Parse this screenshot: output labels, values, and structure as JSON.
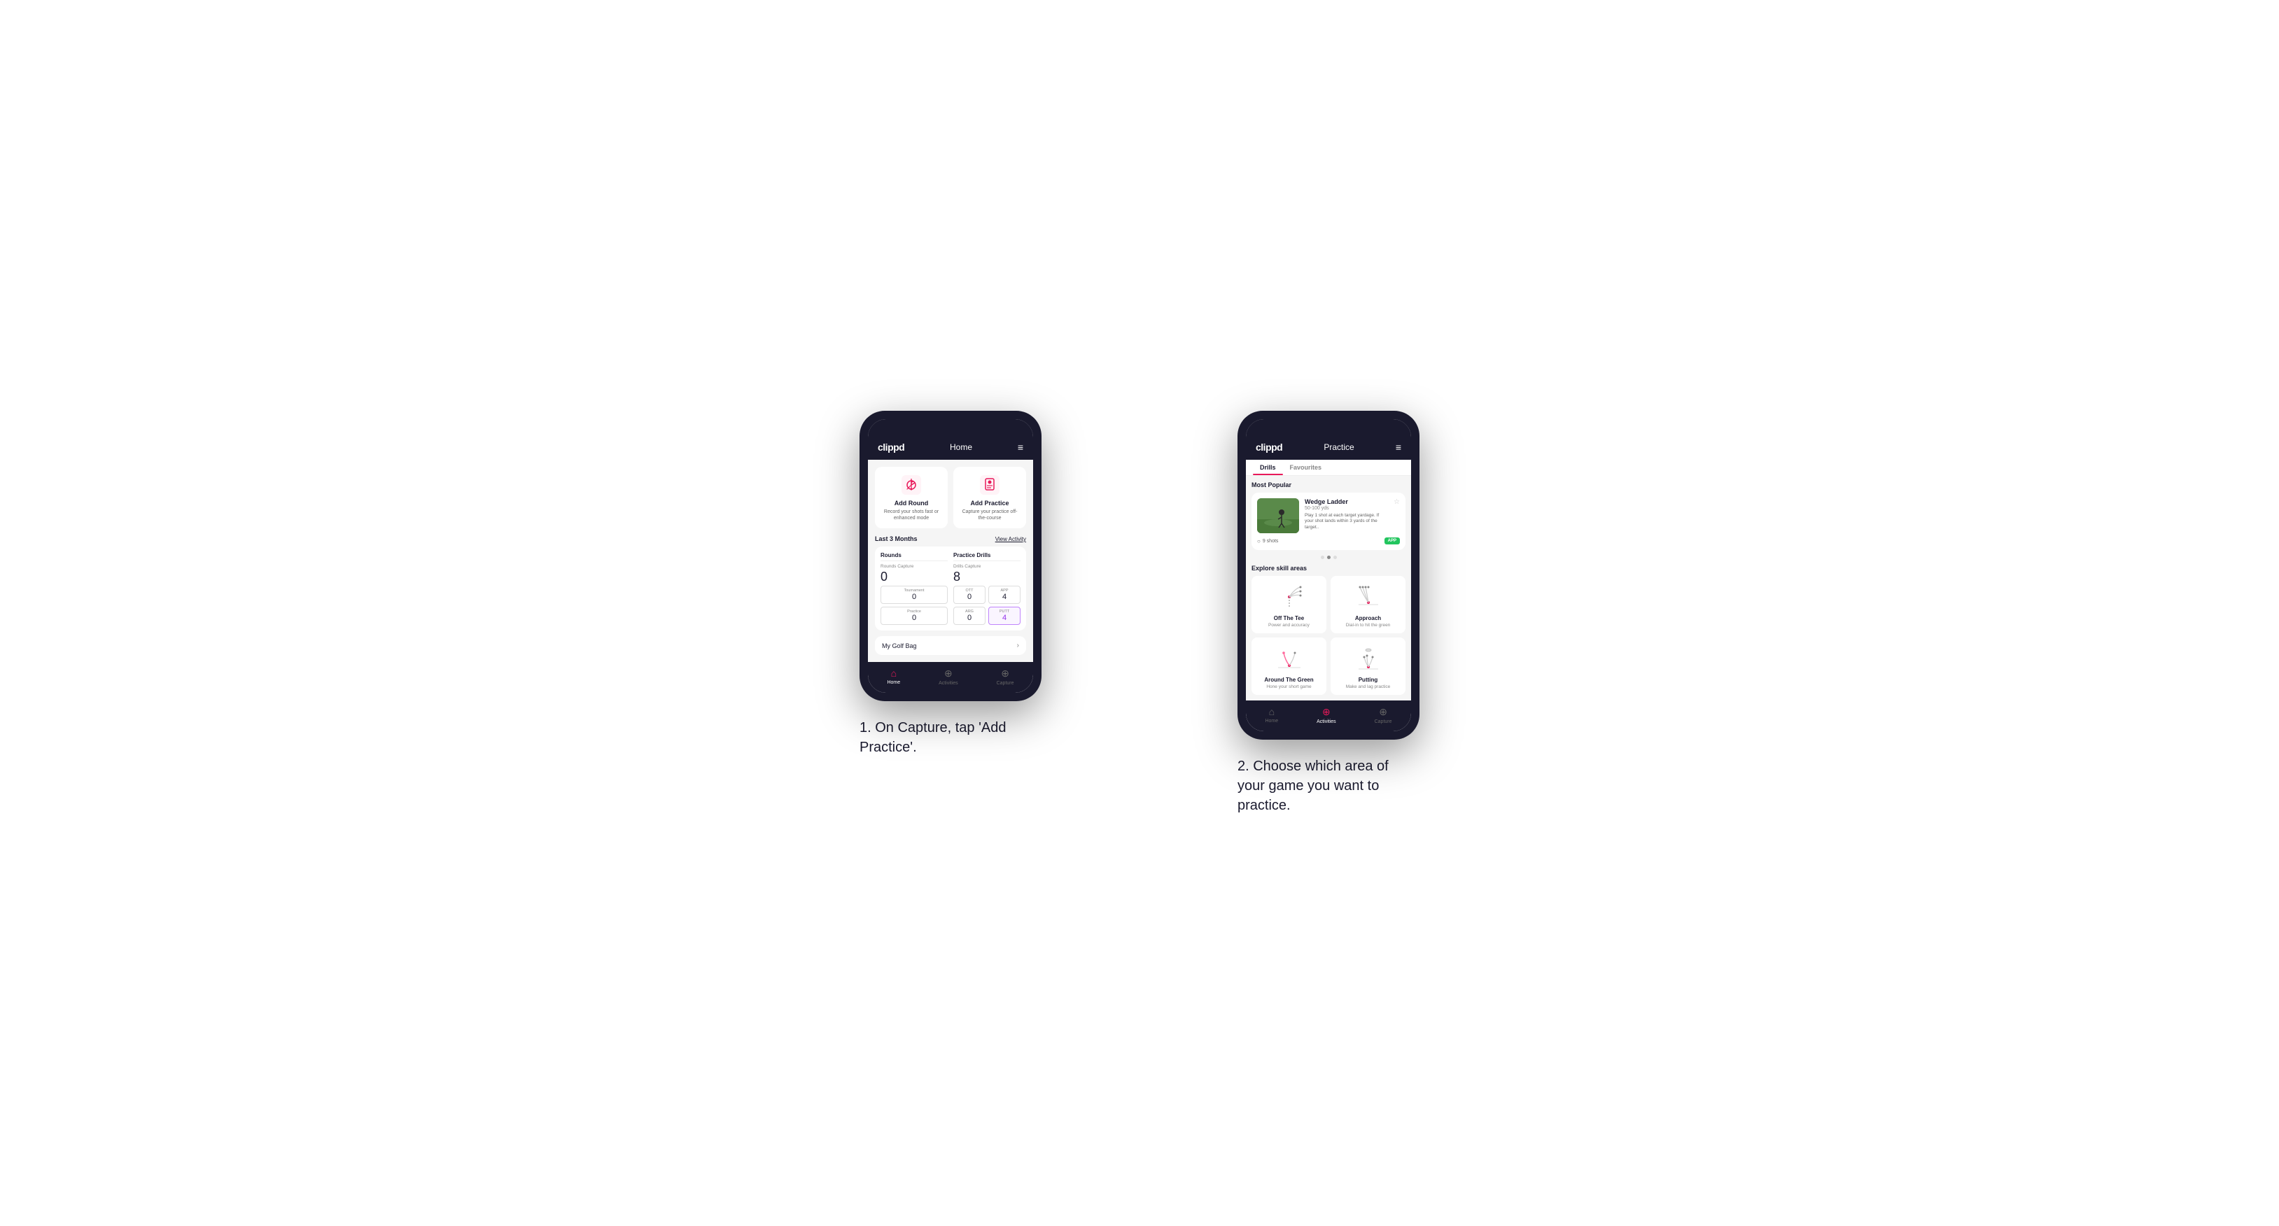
{
  "page": {
    "bg": "#ffffff"
  },
  "phone1": {
    "header": {
      "logo": "clippd",
      "title": "Home",
      "menu_icon": "≡"
    },
    "add_round": {
      "title": "Add Round",
      "subtitle": "Record your shots fast or enhanced mode"
    },
    "add_practice": {
      "title": "Add Practice",
      "subtitle": "Capture your practice off-the-course"
    },
    "stats_header": {
      "period": "Last 3 Months",
      "link": "View Activity"
    },
    "rounds": {
      "title": "Rounds",
      "capture_label": "Rounds Capture",
      "capture_value": "0",
      "tournament_label": "Tournament",
      "tournament_value": "0",
      "practice_label": "Practice",
      "practice_value": "0"
    },
    "practice_drills": {
      "title": "Practice Drills",
      "capture_label": "Drills Capture",
      "capture_value": "8",
      "ott_label": "OTT",
      "ott_value": "0",
      "app_label": "APP",
      "app_value": "4",
      "arg_label": "ARG",
      "arg_value": "0",
      "putt_label": "PUTT",
      "putt_value": "4"
    },
    "golf_bag": "My Golf Bag",
    "nav": {
      "home": "Home",
      "activities": "Activities",
      "capture": "Capture"
    }
  },
  "phone2": {
    "header": {
      "logo": "clippd",
      "title": "Practice",
      "menu_icon": "≡"
    },
    "tabs": [
      "Drills",
      "Favourites"
    ],
    "active_tab": "Drills",
    "most_popular": "Most Popular",
    "featured_drill": {
      "title": "Wedge Ladder",
      "yardage": "50-100 yds",
      "description": "Play 1 shot at each target yardage. If your shot lands within 3 yards of the target..",
      "shots": "9 shots",
      "badge": "APP"
    },
    "explore_label": "Explore skill areas",
    "skills": [
      {
        "title": "Off The Tee",
        "subtitle": "Power and accuracy",
        "icon": "ott"
      },
      {
        "title": "Approach",
        "subtitle": "Dial-in to hit the green",
        "icon": "approach"
      },
      {
        "title": "Around The Green",
        "subtitle": "Hone your short game",
        "icon": "arg"
      },
      {
        "title": "Putting",
        "subtitle": "Make and lag practice",
        "icon": "putt"
      }
    ],
    "nav": {
      "home": "Home",
      "activities": "Activities",
      "capture": "Capture"
    }
  },
  "captions": {
    "caption1": "1. On Capture, tap 'Add Practice'.",
    "caption2": "2. Choose which area of your game you want to practice."
  }
}
